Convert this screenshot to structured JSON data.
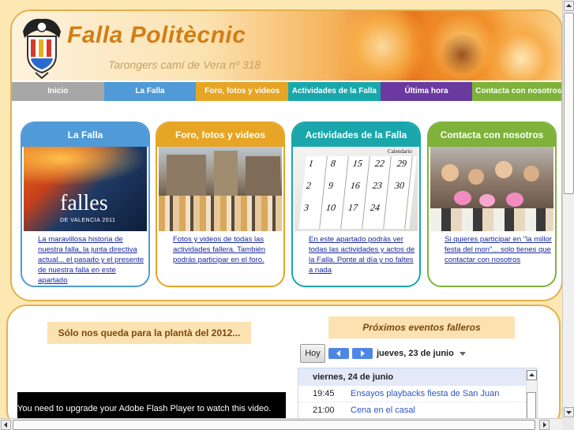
{
  "header": {
    "title": "Falla Politècnic",
    "subtitle": "Tarongers camí de Vera nº 318"
  },
  "nav": {
    "items": [
      "Inicio",
      "La Falla",
      "Foro, fotos y videos",
      "Actividades de la Falla",
      "Última hora",
      "Contacta con nosotros"
    ]
  },
  "cards": [
    {
      "title": "La Falla",
      "text": "La maravillosa historia de nuestra falla, la junta directiva actual... el pasado y el presente de nuestra falla en este apartado",
      "image_text": "falles",
      "image_subtext": "DE VALENCIA 2011"
    },
    {
      "title": "Foro, fotos y videos",
      "text": "Fotos y videos de todas las actividades fallera. También podrás participar en el foro."
    },
    {
      "title": "Actividades de la Falla",
      "text": "En este apartado podrás ver todas las actividades y actos de la Falla. Ponte al día y no faltes a nada",
      "image_text": "Calendario",
      "cal_numbers": [
        "1",
        "8",
        "15",
        "22",
        "29",
        "2",
        "9",
        "16",
        "23",
        "30",
        "3",
        "10",
        "17",
        "24"
      ]
    },
    {
      "title": "Contacta con nosotros",
      "text": "Si quieres participar en \"la millor festa del mon\"... solo tienes que contactar con nosotros"
    }
  ],
  "countdown": {
    "text": "Sólo nos queda para la plantà del 2012..."
  },
  "flash": {
    "text": "You need to upgrade your Adobe Flash Player to watch this video."
  },
  "events": {
    "heading": "Próximos eventos falleros",
    "today_label": "Hoy",
    "current_date": "jueves, 23 de junio",
    "day_heading": "viernes, 24 de junio",
    "items": [
      {
        "time": "19:45",
        "name": "Ensayos playbacks fiesta de San Juan"
      },
      {
        "time": "21:00",
        "name": "Cena en el casal"
      }
    ]
  },
  "colors": {
    "accent": "#d07e16",
    "border": "#e3b04e",
    "nav_inicio": "#a7a7a7",
    "nav_falla": "#4f9ad7",
    "nav_foro": "#e7a525",
    "nav_actividades": "#19a7ac",
    "nav_ultima": "#6a3aa0",
    "nav_contacta": "#7fb23a"
  }
}
